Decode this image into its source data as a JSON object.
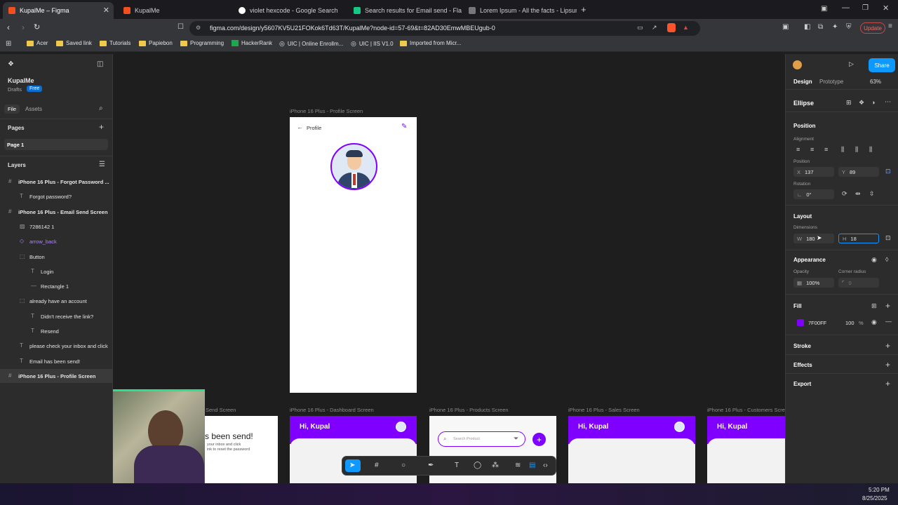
{
  "tabs": [
    {
      "title": "KupalMe – Figma",
      "color": "#f24e1e"
    },
    {
      "title": "KupalMe",
      "color": "#f24e1e"
    },
    {
      "title": "violet hexcode - Google Search",
      "color": "#4285f4"
    },
    {
      "title": "Search results for Email send - Flatic",
      "color": "#16c784"
    },
    {
      "title": "Lorem Ipsum - All the facts - Lipsum",
      "color": "#999999"
    }
  ],
  "address": {
    "url": "figma.com/design/y5607KV5U21FOKok6Td63T/KupalMe?node-id=57-69&t=82AD30EmwMBEUgub-0",
    "update": "Update"
  },
  "bookmarks": [
    "Acer",
    "Saved link",
    "Tutorials",
    "Papiebon",
    "Programming",
    "HackerRank",
    "UIC | Online Enrollm...",
    "UIC | IIS V1.0",
    "Imported from Micr..."
  ],
  "left": {
    "project": "KupalMe",
    "drafts": "Drafts",
    "free": "Free",
    "file_tab": "File",
    "assets_tab": "Assets",
    "pages_title": "Pages",
    "page1": "Page 1",
    "layers_title": "Layers",
    "layers": [
      {
        "label": "iPhone 16 Plus - Forgot Password ...",
        "icon": "#",
        "indent": 0,
        "bold": true
      },
      {
        "label": "Forgot password?",
        "icon": "T",
        "indent": 1
      },
      {
        "label": "iPhone 16 Plus - Email Send Screen",
        "icon": "#",
        "indent": 0,
        "bold": true
      },
      {
        "label": "7286142 1",
        "icon": "▨",
        "indent": 1
      },
      {
        "label": "arrow_back",
        "icon": "◇",
        "indent": 1,
        "purple": true
      },
      {
        "label": "Button",
        "icon": "⬚",
        "indent": 1
      },
      {
        "label": "Login",
        "icon": "T",
        "indent": 2
      },
      {
        "label": "Rectangle 1",
        "icon": "—",
        "indent": 2
      },
      {
        "label": "already have an account",
        "icon": "⬚",
        "indent": 1
      },
      {
        "label": "Didn't receive the link?",
        "icon": "T",
        "indent": 2
      },
      {
        "label": "Resend",
        "icon": "T",
        "indent": 2
      },
      {
        "label": "please check your inbox and click",
        "icon": "T",
        "indent": 1
      },
      {
        "label": "Email has been send!",
        "icon": "T",
        "indent": 1
      },
      {
        "label": "iPhone 16 Plus - Profile Screen",
        "icon": "#",
        "indent": 0,
        "bold": true
      }
    ]
  },
  "canvas": {
    "profile_label": "iPhone 16 Plus - Profile Screen",
    "profile_title": "Profile",
    "bottom_labels": [
      "Send Screen",
      "iPhone 16 Plus - Dashboard Screen",
      "iPhone 16 Plus - Products Screen",
      "iPhone 16 Plus - Sales Screen",
      "iPhone 16 Plus - Customers Scre"
    ],
    "been_send": "s been send!",
    "inbox_line1": "your inbox and click",
    "inbox_line2": "ink to reset the password",
    "hi": "Hi, Kupal",
    "search_placeholder": "Search Product"
  },
  "right": {
    "share": "Share",
    "design": "Design",
    "prototype": "Prototype",
    "zoom": "63%",
    "element": "Ellipse",
    "position_h": "Position",
    "alignment": "Alignment",
    "position_s": "Position",
    "x": "137",
    "y": "89",
    "rotation_s": "Rotation",
    "rotation": "0°",
    "layout_h": "Layout",
    "dimensions": "Dimensions",
    "w": "180",
    "h": "18",
    "appearance_h": "Appearance",
    "opacity_s": "Opacity",
    "radius_s": "Corner radius",
    "opacity": "100%",
    "radius": "0",
    "fill_h": "Fill",
    "fill_hex": "7F00FF",
    "fill_pct": "100",
    "fill_unit": "%",
    "fill_color": "#7f00ff",
    "stroke_h": "Stroke",
    "effects_h": "Effects",
    "export_h": "Export"
  },
  "taskbar": {
    "time": "5:20 PM",
    "date": "8/25/2025"
  }
}
